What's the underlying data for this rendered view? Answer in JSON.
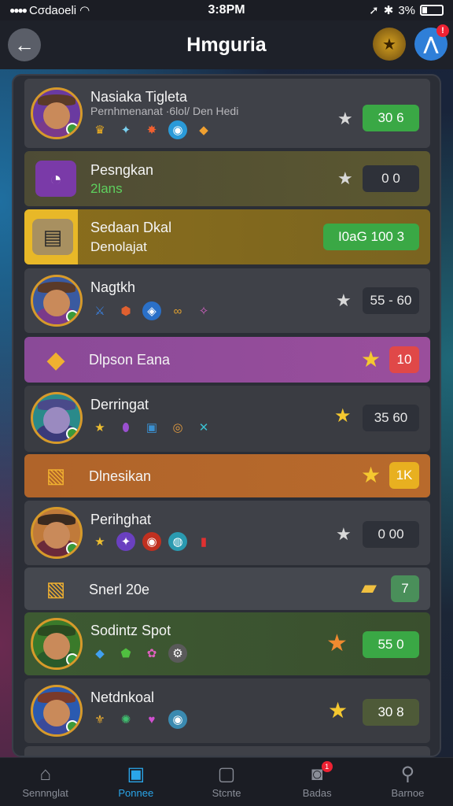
{
  "status": {
    "carrier": "Cσdaoeli",
    "time": "3:8PM",
    "battery": "3%"
  },
  "header": {
    "title": "Hmguria"
  },
  "rows": [
    {
      "name": "Nasiaka Tigleta",
      "sub": "Pernhmenanat ·6lol/ Den Hedi",
      "score": "30   6"
    },
    {
      "name": "Pesngkan",
      "sub": "2lans",
      "score": "0   0"
    },
    {
      "name": "Sedaan Dkal",
      "sub": "Denolajat",
      "score": "I0aG 100  3"
    },
    {
      "name": "Nagtkh",
      "score": "55 - 60"
    },
    {
      "name": "Dlpson Eana",
      "score": "10"
    },
    {
      "name": "Derringat",
      "score": "35  60"
    },
    {
      "name": "Dlnesikan",
      "score": "1K"
    },
    {
      "name": "Perihghat",
      "score": "0  00"
    },
    {
      "name": "Snerl 20e",
      "score": "7"
    },
    {
      "name": "Sodintz Spot",
      "score": "55   0"
    },
    {
      "name": "Netdnkoal",
      "score": "30   8"
    }
  ],
  "nav": [
    {
      "label": "Sennnglat"
    },
    {
      "label": "Ponnee"
    },
    {
      "label": "Stcnte"
    },
    {
      "label": "Badas",
      "badge": "1"
    },
    {
      "label": "Barnoe"
    }
  ],
  "colors": {
    "accent": "#2aa6ea",
    "score_green": "#3aa845",
    "score_red": "#e04848",
    "score_yellow": "#e8b020"
  }
}
